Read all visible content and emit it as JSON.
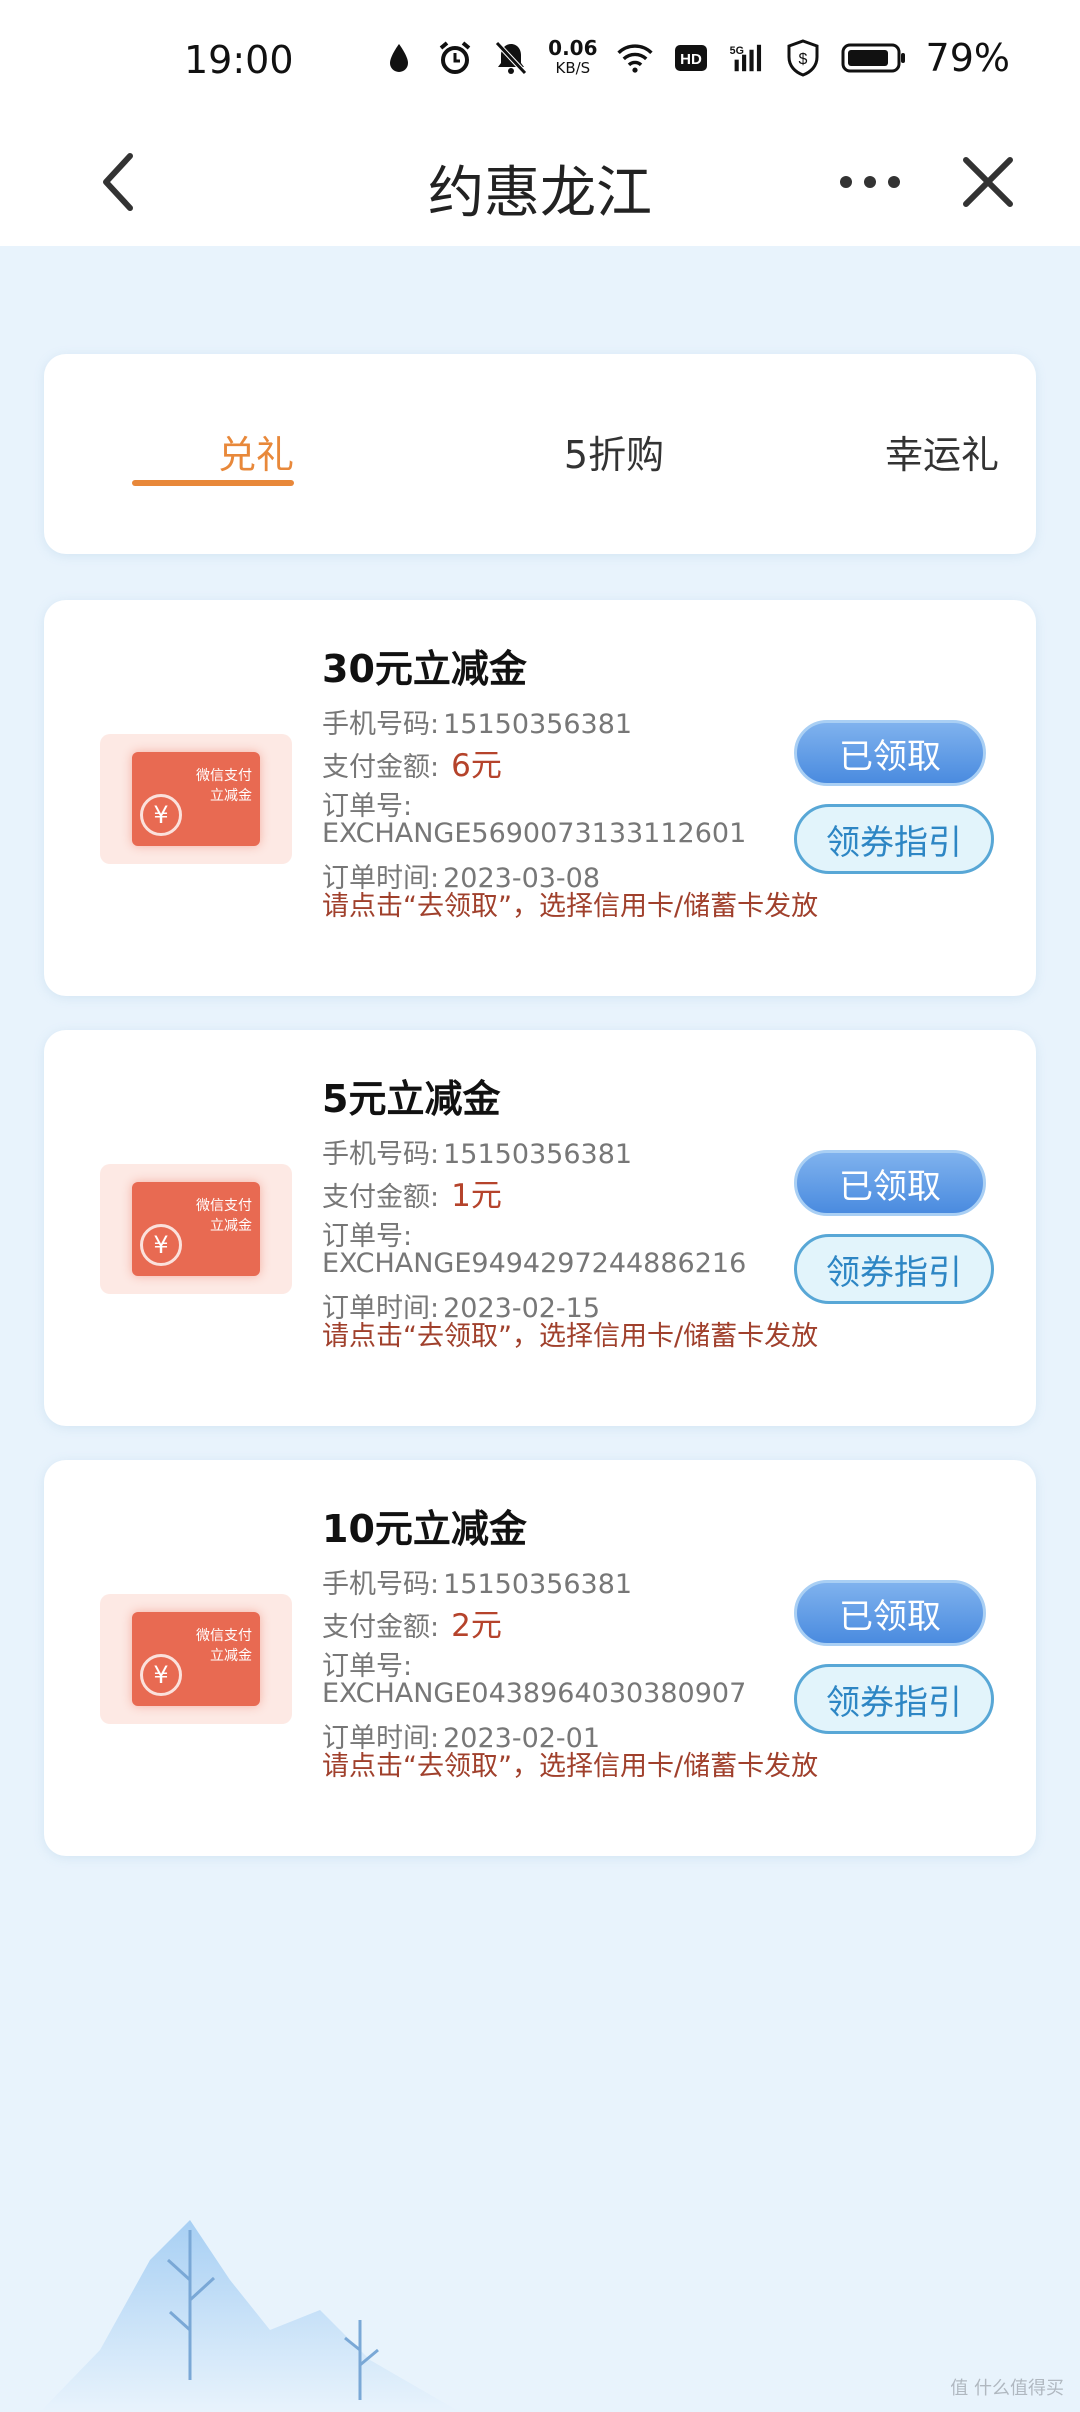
{
  "status": {
    "time": "19:00",
    "net_speed_value": "0.06",
    "net_speed_unit": "KB/S",
    "battery_pct": "79%"
  },
  "nav": {
    "title": "约惠龙江"
  },
  "tabs": [
    {
      "label": "兑礼",
      "active": true
    },
    {
      "label": "5折购",
      "active": false
    },
    {
      "label": "幸运礼",
      "active": false
    }
  ],
  "coupons": [
    {
      "title": "30元立减金",
      "phone_label": "手机号码:",
      "phone": "15150356381",
      "pay_label": "支付金额:",
      "pay_amount": "6元",
      "order_label": "订单号:",
      "order_no": "EXCHANGE5690073133112601",
      "time_label": "订单时间:",
      "order_time": "2023-03-08",
      "notice": "请点击“去领取”，选择信用卡/储蓄卡发放",
      "thumb_line1": "微信支付",
      "thumb_line2": "立减金",
      "btn_claimed": "已领取",
      "btn_guide": "领券指引"
    },
    {
      "title": "5元立减金",
      "phone_label": "手机号码:",
      "phone": "15150356381",
      "pay_label": "支付金额:",
      "pay_amount": "1元",
      "order_label": "订单号:",
      "order_no": "EXCHANGE9494297244886216",
      "time_label": "订单时间:",
      "order_time": "2023-02-15",
      "notice": "请点击“去领取”，选择信用卡/储蓄卡发放",
      "thumb_line1": "微信支付",
      "thumb_line2": "立减金",
      "btn_claimed": "已领取",
      "btn_guide": "领券指引"
    },
    {
      "title": "10元立减金",
      "phone_label": "手机号码:",
      "phone": "15150356381",
      "pay_label": "支付金额:",
      "pay_amount": "2元",
      "order_label": "订单号:",
      "order_no": "EXCHANGE0438964030380907",
      "time_label": "订单时间:",
      "order_time": "2023-02-01",
      "notice": "请点击“去领取”，选择信用卡/储蓄卡发放",
      "thumb_line1": "微信支付",
      "thumb_line2": "立减金",
      "btn_claimed": "已领取",
      "btn_guide": "领券指引"
    }
  ],
  "watermark": "值 什么值得买",
  "colors": {
    "accent": "#e8883a",
    "amount": "#b5432b",
    "button_blue": "#4a8bdf",
    "background": "#e8f3fc"
  }
}
